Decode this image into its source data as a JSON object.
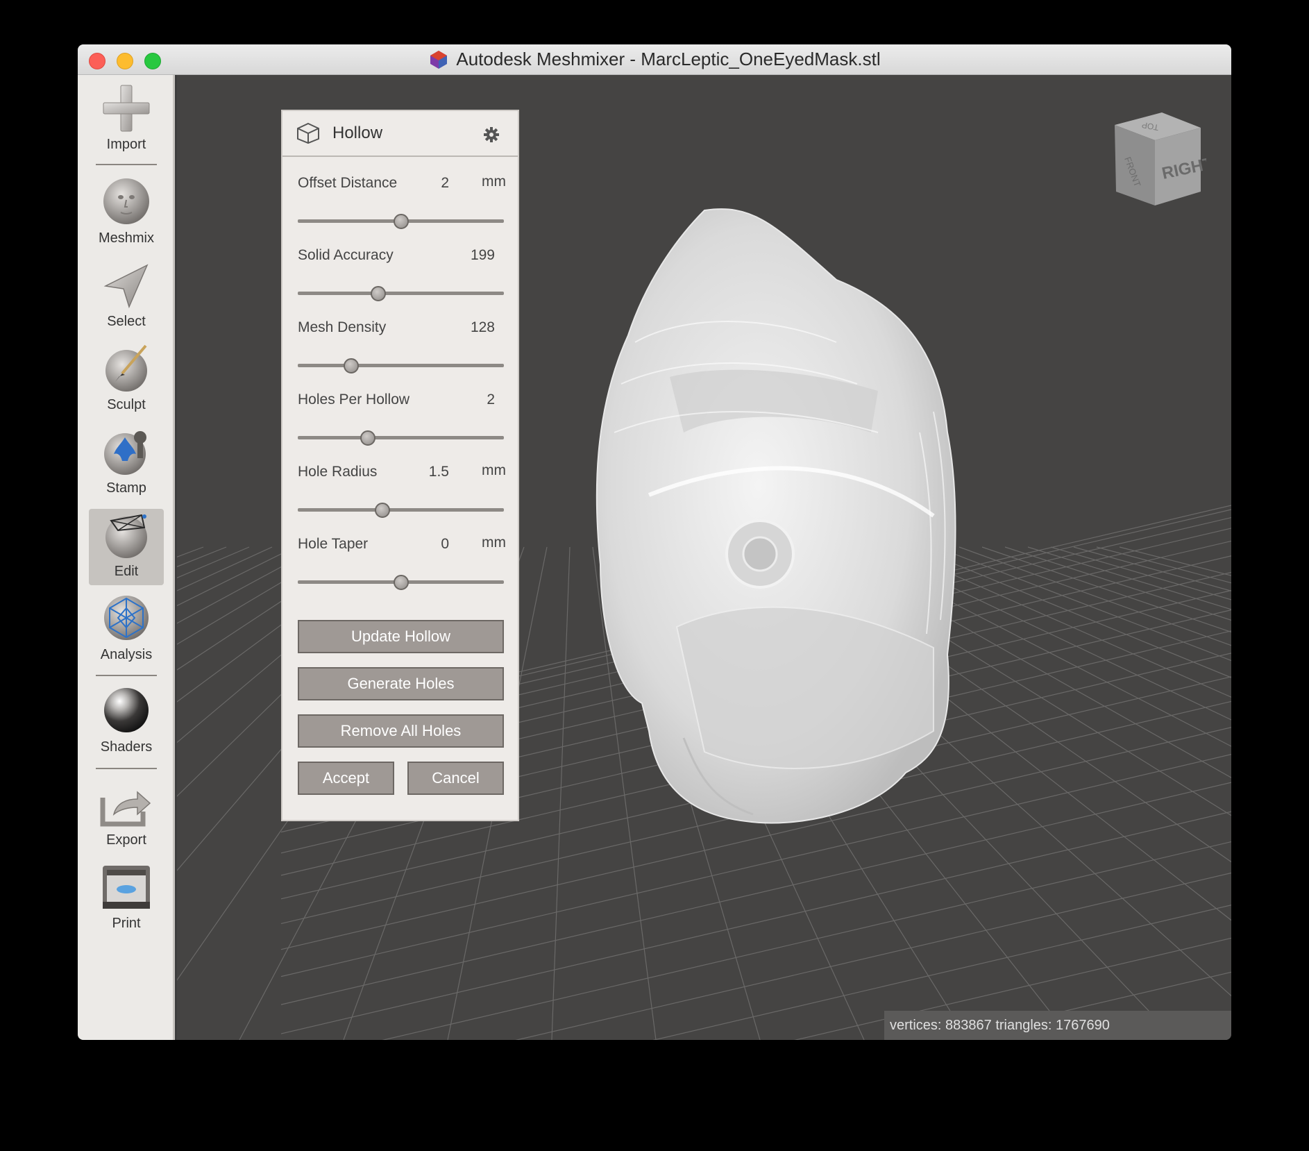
{
  "window": {
    "title": "Autodesk Meshmixer - MarcLeptic_OneEyedMask.stl"
  },
  "toolbar": {
    "items": [
      {
        "label": "Import",
        "icon": "plus-icon"
      },
      {
        "label": "Meshmix",
        "icon": "face-sphere-icon"
      },
      {
        "label": "Select",
        "icon": "arrow-cursor-icon"
      },
      {
        "label": "Sculpt",
        "icon": "brush-sphere-icon"
      },
      {
        "label": "Stamp",
        "icon": "stamp-icon"
      },
      {
        "label": "Edit",
        "icon": "edit-sphere-icon",
        "active": true
      },
      {
        "label": "Analysis",
        "icon": "analysis-sphere-icon"
      },
      {
        "label": "Shaders",
        "icon": "shader-sphere-icon"
      },
      {
        "label": "Export",
        "icon": "export-icon"
      },
      {
        "label": "Print",
        "icon": "printer-icon"
      }
    ]
  },
  "panel": {
    "title": "Hollow",
    "icon": "cube-outline-icon",
    "settings_icon": "gear-icon",
    "params": [
      {
        "label": "Offset Distance",
        "value": "2",
        "unit": "mm",
        "slider_fraction": 0.5
      },
      {
        "label": "Solid Accuracy",
        "value": "199",
        "unit": "",
        "slider_fraction": 0.39
      },
      {
        "label": "Mesh Density",
        "value": "128",
        "unit": "",
        "slider_fraction": 0.26
      },
      {
        "label": "Holes Per Hollow",
        "value": "2",
        "unit": "",
        "slider_fraction": 0.34
      },
      {
        "label": "Hole Radius",
        "value": "1.5",
        "unit": "mm",
        "slider_fraction": 0.41
      },
      {
        "label": "Hole Taper",
        "value": "0",
        "unit": "mm",
        "slider_fraction": 0.5
      }
    ],
    "buttons": {
      "update_hollow": "Update Hollow",
      "generate_holes": "Generate Holes",
      "remove_all_holes": "Remove All Holes",
      "accept": "Accept",
      "cancel": "Cancel"
    }
  },
  "viewport": {
    "navcube_label": "RIGHT",
    "navcube_side_label": "FRONT",
    "navcube_top_label": "TOP",
    "stats": "vertices: 883867 triangles: 1767690"
  },
  "colors": {
    "viewport_bg": "#454443",
    "panel_bg": "#eeebe8",
    "button_bg": "#9f9995",
    "toolbar_bg": "#eceae7"
  }
}
